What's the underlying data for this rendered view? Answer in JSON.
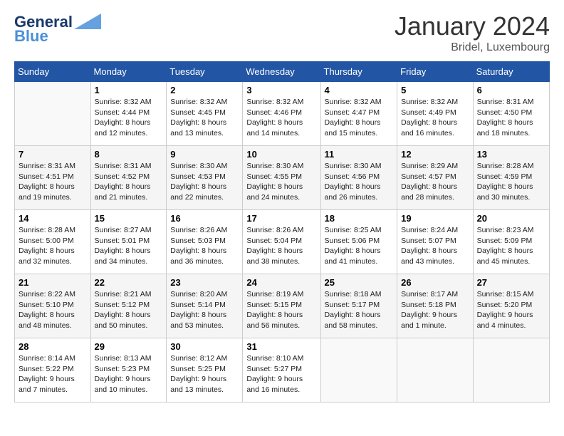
{
  "header": {
    "logo_line1": "General",
    "logo_line2": "Blue",
    "month": "January 2024",
    "location": "Bridel, Luxembourg"
  },
  "weekdays": [
    "Sunday",
    "Monday",
    "Tuesday",
    "Wednesday",
    "Thursday",
    "Friday",
    "Saturday"
  ],
  "weeks": [
    [
      {
        "date": "",
        "info": ""
      },
      {
        "date": "1",
        "info": "Sunrise: 8:32 AM\nSunset: 4:44 PM\nDaylight: 8 hours\nand 12 minutes."
      },
      {
        "date": "2",
        "info": "Sunrise: 8:32 AM\nSunset: 4:45 PM\nDaylight: 8 hours\nand 13 minutes."
      },
      {
        "date": "3",
        "info": "Sunrise: 8:32 AM\nSunset: 4:46 PM\nDaylight: 8 hours\nand 14 minutes."
      },
      {
        "date": "4",
        "info": "Sunrise: 8:32 AM\nSunset: 4:47 PM\nDaylight: 8 hours\nand 15 minutes."
      },
      {
        "date": "5",
        "info": "Sunrise: 8:32 AM\nSunset: 4:49 PM\nDaylight: 8 hours\nand 16 minutes."
      },
      {
        "date": "6",
        "info": "Sunrise: 8:31 AM\nSunset: 4:50 PM\nDaylight: 8 hours\nand 18 minutes."
      }
    ],
    [
      {
        "date": "7",
        "info": "Sunrise: 8:31 AM\nSunset: 4:51 PM\nDaylight: 8 hours\nand 19 minutes."
      },
      {
        "date": "8",
        "info": "Sunrise: 8:31 AM\nSunset: 4:52 PM\nDaylight: 8 hours\nand 21 minutes."
      },
      {
        "date": "9",
        "info": "Sunrise: 8:30 AM\nSunset: 4:53 PM\nDaylight: 8 hours\nand 22 minutes."
      },
      {
        "date": "10",
        "info": "Sunrise: 8:30 AM\nSunset: 4:55 PM\nDaylight: 8 hours\nand 24 minutes."
      },
      {
        "date": "11",
        "info": "Sunrise: 8:30 AM\nSunset: 4:56 PM\nDaylight: 8 hours\nand 26 minutes."
      },
      {
        "date": "12",
        "info": "Sunrise: 8:29 AM\nSunset: 4:57 PM\nDaylight: 8 hours\nand 28 minutes."
      },
      {
        "date": "13",
        "info": "Sunrise: 8:28 AM\nSunset: 4:59 PM\nDaylight: 8 hours\nand 30 minutes."
      }
    ],
    [
      {
        "date": "14",
        "info": "Sunrise: 8:28 AM\nSunset: 5:00 PM\nDaylight: 8 hours\nand 32 minutes."
      },
      {
        "date": "15",
        "info": "Sunrise: 8:27 AM\nSunset: 5:01 PM\nDaylight: 8 hours\nand 34 minutes."
      },
      {
        "date": "16",
        "info": "Sunrise: 8:26 AM\nSunset: 5:03 PM\nDaylight: 8 hours\nand 36 minutes."
      },
      {
        "date": "17",
        "info": "Sunrise: 8:26 AM\nSunset: 5:04 PM\nDaylight: 8 hours\nand 38 minutes."
      },
      {
        "date": "18",
        "info": "Sunrise: 8:25 AM\nSunset: 5:06 PM\nDaylight: 8 hours\nand 41 minutes."
      },
      {
        "date": "19",
        "info": "Sunrise: 8:24 AM\nSunset: 5:07 PM\nDaylight: 8 hours\nand 43 minutes."
      },
      {
        "date": "20",
        "info": "Sunrise: 8:23 AM\nSunset: 5:09 PM\nDaylight: 8 hours\nand 45 minutes."
      }
    ],
    [
      {
        "date": "21",
        "info": "Sunrise: 8:22 AM\nSunset: 5:10 PM\nDaylight: 8 hours\nand 48 minutes."
      },
      {
        "date": "22",
        "info": "Sunrise: 8:21 AM\nSunset: 5:12 PM\nDaylight: 8 hours\nand 50 minutes."
      },
      {
        "date": "23",
        "info": "Sunrise: 8:20 AM\nSunset: 5:14 PM\nDaylight: 8 hours\nand 53 minutes."
      },
      {
        "date": "24",
        "info": "Sunrise: 8:19 AM\nSunset: 5:15 PM\nDaylight: 8 hours\nand 56 minutes."
      },
      {
        "date": "25",
        "info": "Sunrise: 8:18 AM\nSunset: 5:17 PM\nDaylight: 8 hours\nand 58 minutes."
      },
      {
        "date": "26",
        "info": "Sunrise: 8:17 AM\nSunset: 5:18 PM\nDaylight: 9 hours\nand 1 minute."
      },
      {
        "date": "27",
        "info": "Sunrise: 8:15 AM\nSunset: 5:20 PM\nDaylight: 9 hours\nand 4 minutes."
      }
    ],
    [
      {
        "date": "28",
        "info": "Sunrise: 8:14 AM\nSunset: 5:22 PM\nDaylight: 9 hours\nand 7 minutes."
      },
      {
        "date": "29",
        "info": "Sunrise: 8:13 AM\nSunset: 5:23 PM\nDaylight: 9 hours\nand 10 minutes."
      },
      {
        "date": "30",
        "info": "Sunrise: 8:12 AM\nSunset: 5:25 PM\nDaylight: 9 hours\nand 13 minutes."
      },
      {
        "date": "31",
        "info": "Sunrise: 8:10 AM\nSunset: 5:27 PM\nDaylight: 9 hours\nand 16 minutes."
      },
      {
        "date": "",
        "info": ""
      },
      {
        "date": "",
        "info": ""
      },
      {
        "date": "",
        "info": ""
      }
    ]
  ]
}
